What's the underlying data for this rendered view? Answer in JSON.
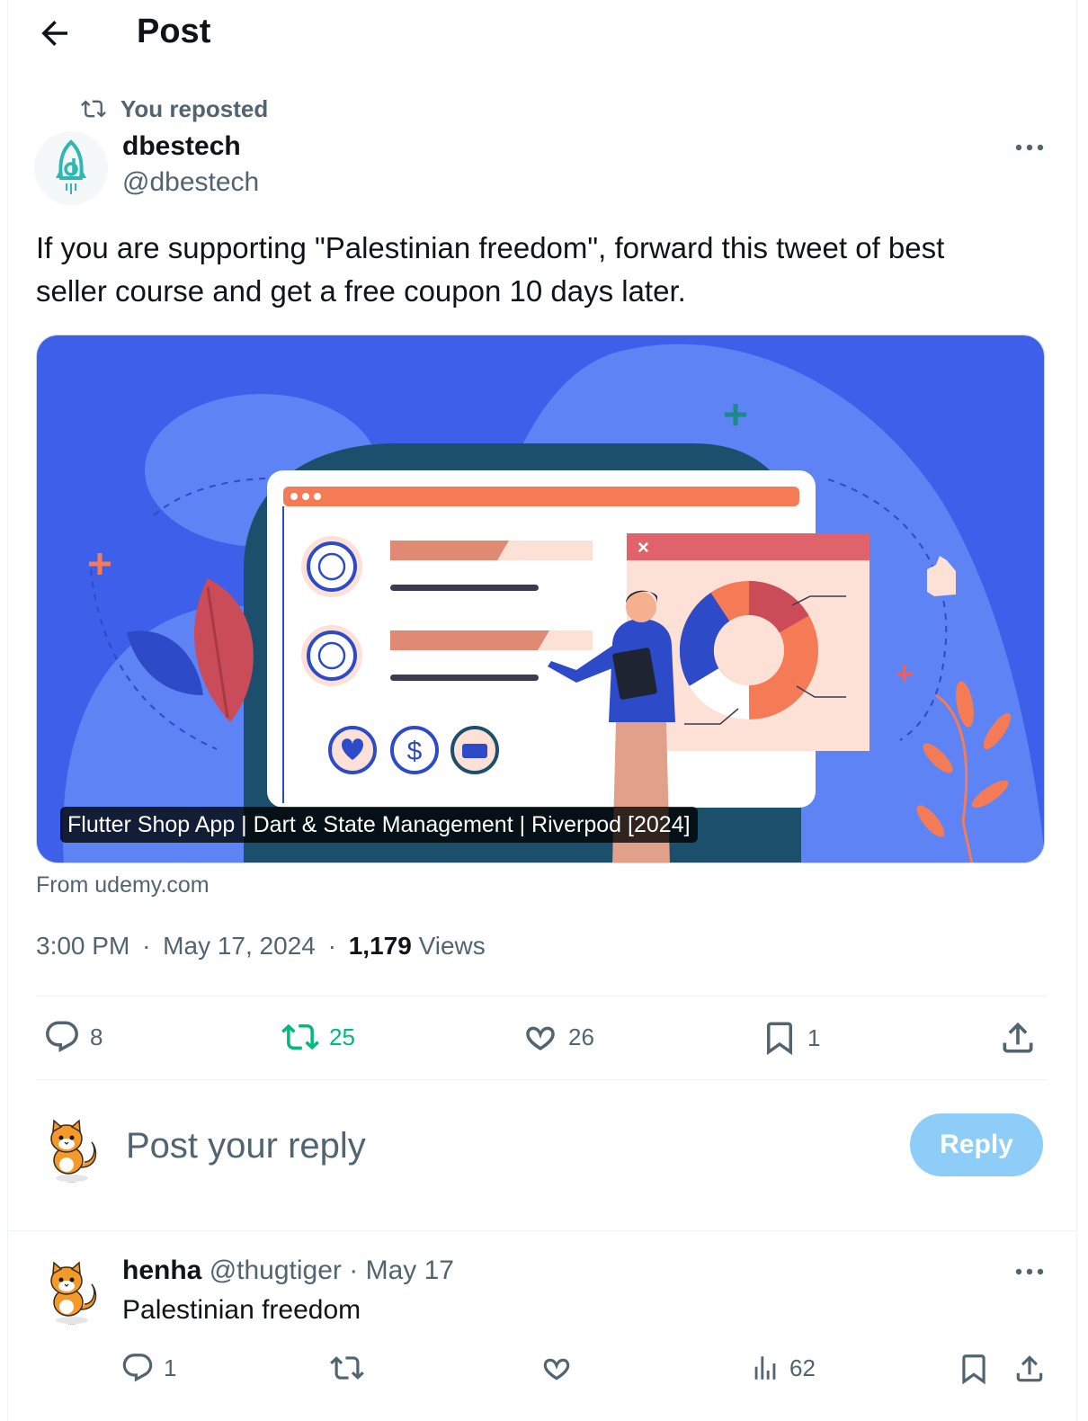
{
  "header": {
    "title": "Post",
    "back_icon": "arrow-left-icon"
  },
  "repost": {
    "label": "You reposted",
    "icon": "repost-icon"
  },
  "author": {
    "name": "dbestech",
    "handle": "@dbestech",
    "avatar": "rocket-logo"
  },
  "post": {
    "text_line1": "If you are supporting \"Palestinian freedom\", forward this tweet of best",
    "text_line2": "seller course and get a free coupon 10 days later."
  },
  "card": {
    "caption": "Flutter Shop App | Dart & State Management | Riverpod [2024]",
    "source": "From udemy.com"
  },
  "meta": {
    "time": "3:00 PM",
    "date": "May 17, 2024",
    "views_count": "1,179",
    "views_label": "Views",
    "separator": "·"
  },
  "actions": {
    "replies": "8",
    "reposts": "25",
    "likes": "26",
    "bookmarks": "1"
  },
  "reply_box": {
    "placeholder": "Post your reply",
    "button": "Reply"
  },
  "comment": {
    "name": "henha",
    "handle": "@thugtiger",
    "date_sep": "·",
    "date": "May 17",
    "text": "Palestinian freedom",
    "replies": "1",
    "views": "62"
  },
  "colors": {
    "accent": "#1d9bf0",
    "repost_green": "#00ba7c",
    "reply_button": "#8ecdf8",
    "muted": "#536471",
    "card_bg": "#3d5fea"
  }
}
